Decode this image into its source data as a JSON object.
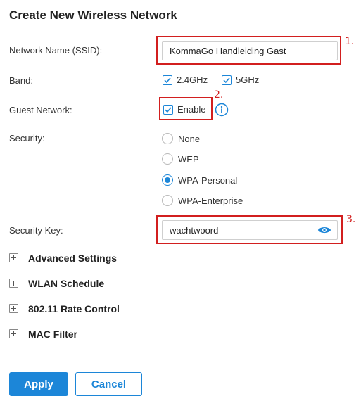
{
  "header": {
    "title": "Create New Wireless Network"
  },
  "form": {
    "ssid": {
      "label": "Network Name (SSID):",
      "value": "KommaGo Handleiding Gast"
    },
    "band": {
      "label": "Band:",
      "options": [
        {
          "label": "2.4GHz",
          "checked": true
        },
        {
          "label": "5GHz",
          "checked": true
        }
      ]
    },
    "guest": {
      "label": "Guest Network:",
      "checkbox_label": "Enable",
      "checked": true,
      "info_icon": "info-icon"
    },
    "security": {
      "label": "Security:",
      "options": [
        {
          "label": "None",
          "selected": false
        },
        {
          "label": "WEP",
          "selected": false
        },
        {
          "label": "WPA-Personal",
          "selected": true
        },
        {
          "label": "WPA-Enterprise",
          "selected": false
        }
      ]
    },
    "security_key": {
      "label": "Security Key:",
      "value": "wachtwoord",
      "toggle_icon": "eye-icon"
    }
  },
  "sections": [
    {
      "label": "Advanced Settings"
    },
    {
      "label": "WLAN Schedule"
    },
    {
      "label": "802.11 Rate Control"
    },
    {
      "label": "MAC Filter"
    }
  ],
  "buttons": {
    "apply": "Apply",
    "cancel": "Cancel"
  },
  "annotations": {
    "one": "1.",
    "two": "2.",
    "three": "3."
  },
  "colors": {
    "accent": "#1c86d8",
    "annotation": "#d21f1f"
  }
}
